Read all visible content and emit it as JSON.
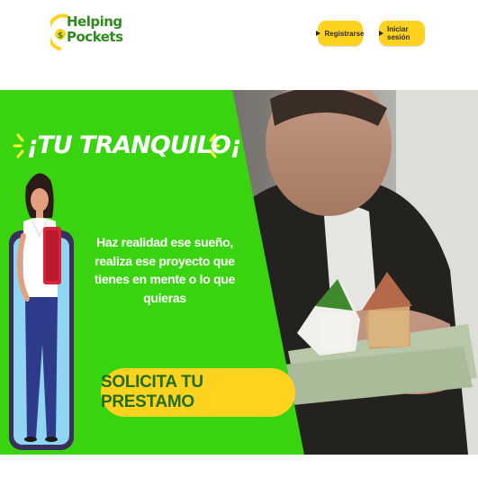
{
  "brand": {
    "line1": "Helping",
    "line2": "Pockets"
  },
  "nav": {
    "register_label": "Registrarse",
    "login_label": "Iniciar sesión"
  },
  "hero": {
    "title": "¡TU TRANQUILO¡",
    "body": "Haz realidad ese sueño, realiza ese proyecto que tienes en mente o lo que quieras",
    "cta_label": "SOLICITA TU PRESTAMO"
  },
  "colors": {
    "green": "#39d40f",
    "yellow": "#ffd21f",
    "brand_green": "#2f8a1f"
  }
}
